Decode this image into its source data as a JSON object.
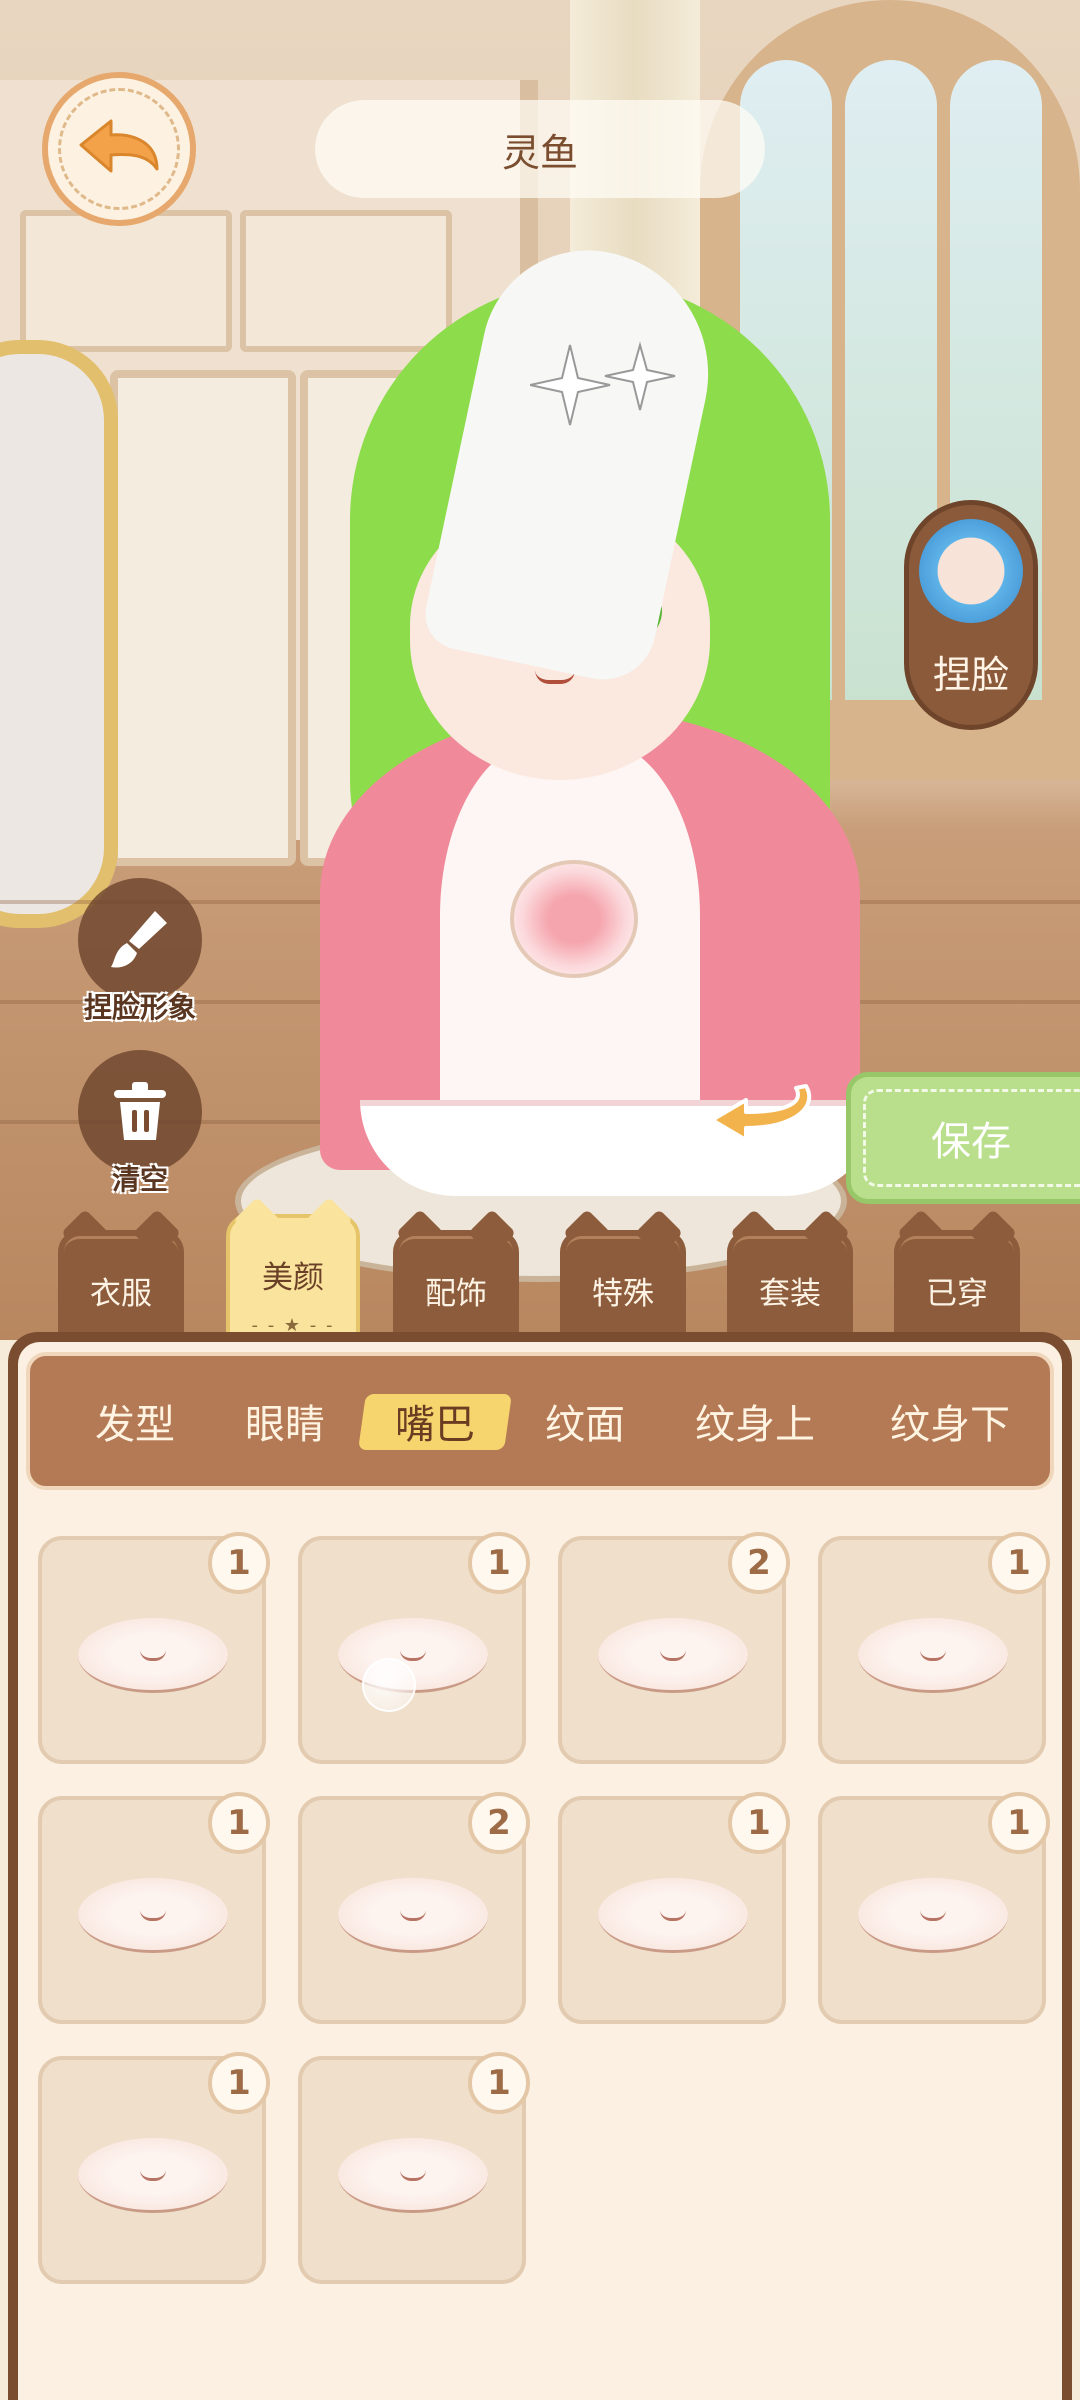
{
  "header": {
    "back_icon": "back-arrow-icon",
    "character_name": "灵鱼"
  },
  "right_controls": {
    "pinch_face_label": "捏脸",
    "save_label": "保存"
  },
  "left_controls": {
    "pinch_face_look_label": "捏脸形象",
    "pinch_face_look_icon": "brush-icon",
    "clear_label": "清空",
    "clear_icon": "trash-icon"
  },
  "category_tabs": [
    {
      "label": "衣服",
      "active": false
    },
    {
      "label": "美颜",
      "active": true
    },
    {
      "label": "配饰",
      "active": false
    },
    {
      "label": "特殊",
      "active": false
    },
    {
      "label": "套装",
      "active": false
    },
    {
      "label": "已穿",
      "active": false
    }
  ],
  "sub_tabs": [
    {
      "label": "发型",
      "active": false
    },
    {
      "label": "眼睛",
      "active": false
    },
    {
      "label": "嘴巴",
      "active": true
    },
    {
      "label": "纹面",
      "active": false
    },
    {
      "label": "纹身上",
      "active": false
    },
    {
      "label": "纹身下",
      "active": false
    }
  ],
  "items": [
    {
      "count": "1"
    },
    {
      "count": "1"
    },
    {
      "count": "2"
    },
    {
      "count": "1"
    },
    {
      "count": "1"
    },
    {
      "count": "2"
    },
    {
      "count": "1"
    },
    {
      "count": "1"
    },
    {
      "count": "1"
    },
    {
      "count": "1"
    }
  ],
  "colors": {
    "panel_brown": "#7b4d30",
    "subtab_bar": "#b47955",
    "active_highlight": "#f6d56e",
    "save_green": "#b9df8c"
  }
}
